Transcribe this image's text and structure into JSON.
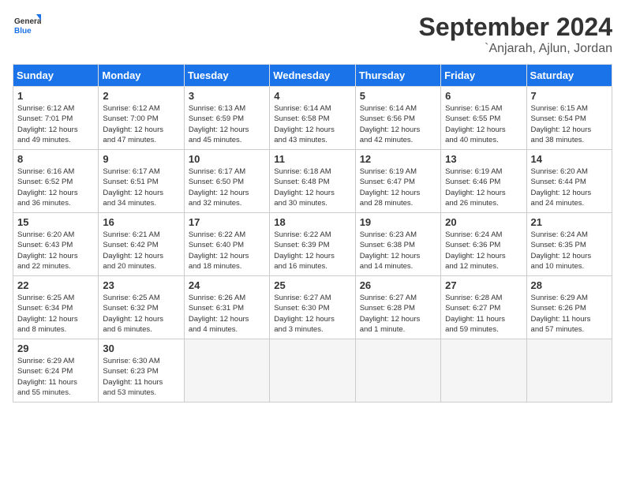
{
  "header": {
    "logo_general": "General",
    "logo_blue": "Blue",
    "month": "September 2024",
    "location": "`Anjarah, Ajlun, Jordan"
  },
  "weekdays": [
    "Sunday",
    "Monday",
    "Tuesday",
    "Wednesday",
    "Thursday",
    "Friday",
    "Saturday"
  ],
  "weeks": [
    [
      {
        "day": "1",
        "sunrise": "6:12 AM",
        "sunset": "7:01 PM",
        "daylight": "12 hours and 49 minutes."
      },
      {
        "day": "2",
        "sunrise": "6:12 AM",
        "sunset": "7:00 PM",
        "daylight": "12 hours and 47 minutes."
      },
      {
        "day": "3",
        "sunrise": "6:13 AM",
        "sunset": "6:59 PM",
        "daylight": "12 hours and 45 minutes."
      },
      {
        "day": "4",
        "sunrise": "6:14 AM",
        "sunset": "6:58 PM",
        "daylight": "12 hours and 43 minutes."
      },
      {
        "day": "5",
        "sunrise": "6:14 AM",
        "sunset": "6:56 PM",
        "daylight": "12 hours and 42 minutes."
      },
      {
        "day": "6",
        "sunrise": "6:15 AM",
        "sunset": "6:55 PM",
        "daylight": "12 hours and 40 minutes."
      },
      {
        "day": "7",
        "sunrise": "6:15 AM",
        "sunset": "6:54 PM",
        "daylight": "12 hours and 38 minutes."
      }
    ],
    [
      {
        "day": "8",
        "sunrise": "6:16 AM",
        "sunset": "6:52 PM",
        "daylight": "12 hours and 36 minutes."
      },
      {
        "day": "9",
        "sunrise": "6:17 AM",
        "sunset": "6:51 PM",
        "daylight": "12 hours and 34 minutes."
      },
      {
        "day": "10",
        "sunrise": "6:17 AM",
        "sunset": "6:50 PM",
        "daylight": "12 hours and 32 minutes."
      },
      {
        "day": "11",
        "sunrise": "6:18 AM",
        "sunset": "6:48 PM",
        "daylight": "12 hours and 30 minutes."
      },
      {
        "day": "12",
        "sunrise": "6:19 AM",
        "sunset": "6:47 PM",
        "daylight": "12 hours and 28 minutes."
      },
      {
        "day": "13",
        "sunrise": "6:19 AM",
        "sunset": "6:46 PM",
        "daylight": "12 hours and 26 minutes."
      },
      {
        "day": "14",
        "sunrise": "6:20 AM",
        "sunset": "6:44 PM",
        "daylight": "12 hours and 24 minutes."
      }
    ],
    [
      {
        "day": "15",
        "sunrise": "6:20 AM",
        "sunset": "6:43 PM",
        "daylight": "12 hours and 22 minutes."
      },
      {
        "day": "16",
        "sunrise": "6:21 AM",
        "sunset": "6:42 PM",
        "daylight": "12 hours and 20 minutes."
      },
      {
        "day": "17",
        "sunrise": "6:22 AM",
        "sunset": "6:40 PM",
        "daylight": "12 hours and 18 minutes."
      },
      {
        "day": "18",
        "sunrise": "6:22 AM",
        "sunset": "6:39 PM",
        "daylight": "12 hours and 16 minutes."
      },
      {
        "day": "19",
        "sunrise": "6:23 AM",
        "sunset": "6:38 PM",
        "daylight": "12 hours and 14 minutes."
      },
      {
        "day": "20",
        "sunrise": "6:24 AM",
        "sunset": "6:36 PM",
        "daylight": "12 hours and 12 minutes."
      },
      {
        "day": "21",
        "sunrise": "6:24 AM",
        "sunset": "6:35 PM",
        "daylight": "12 hours and 10 minutes."
      }
    ],
    [
      {
        "day": "22",
        "sunrise": "6:25 AM",
        "sunset": "6:34 PM",
        "daylight": "12 hours and 8 minutes."
      },
      {
        "day": "23",
        "sunrise": "6:25 AM",
        "sunset": "6:32 PM",
        "daylight": "12 hours and 6 minutes."
      },
      {
        "day": "24",
        "sunrise": "6:26 AM",
        "sunset": "6:31 PM",
        "daylight": "12 hours and 4 minutes."
      },
      {
        "day": "25",
        "sunrise": "6:27 AM",
        "sunset": "6:30 PM",
        "daylight": "12 hours and 3 minutes."
      },
      {
        "day": "26",
        "sunrise": "6:27 AM",
        "sunset": "6:28 PM",
        "daylight": "12 hours and 1 minute."
      },
      {
        "day": "27",
        "sunrise": "6:28 AM",
        "sunset": "6:27 PM",
        "daylight": "11 hours and 59 minutes."
      },
      {
        "day": "28",
        "sunrise": "6:29 AM",
        "sunset": "6:26 PM",
        "daylight": "11 hours and 57 minutes."
      }
    ],
    [
      {
        "day": "29",
        "sunrise": "6:29 AM",
        "sunset": "6:24 PM",
        "daylight": "11 hours and 55 minutes."
      },
      {
        "day": "30",
        "sunrise": "6:30 AM",
        "sunset": "6:23 PM",
        "daylight": "11 hours and 53 minutes."
      },
      null,
      null,
      null,
      null,
      null
    ]
  ]
}
